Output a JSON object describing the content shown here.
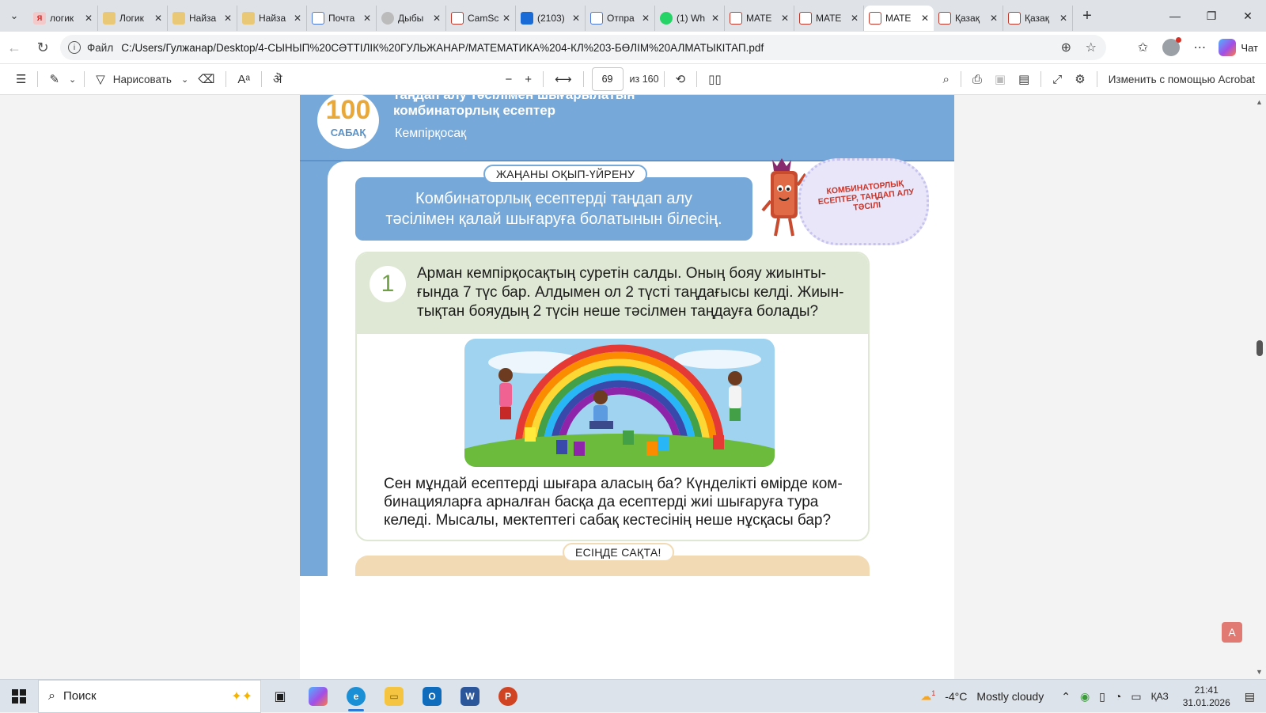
{
  "browser": {
    "tabs": [
      {
        "title": "логик",
        "icon": "yandex-icon"
      },
      {
        "title": "Логик",
        "icon": "image-icon"
      },
      {
        "title": "Найза",
        "icon": "image-icon"
      },
      {
        "title": "Найза",
        "icon": "image-icon"
      },
      {
        "title": "Почта",
        "icon": "mail-icon"
      },
      {
        "title": "Дыбы",
        "icon": "gear-icon"
      },
      {
        "title": "CamSc",
        "icon": "pdf-icon"
      },
      {
        "title": "(2103)",
        "icon": "outlook-icon"
      },
      {
        "title": "Отпра",
        "icon": "mail-icon"
      },
      {
        "title": "(1) Wh",
        "icon": "whatsapp-icon"
      },
      {
        "title": "МАТЕ",
        "icon": "pdf-icon"
      },
      {
        "title": "МАТЕ",
        "icon": "pdf-icon"
      },
      {
        "title": "МАТЕ",
        "icon": "pdf-icon",
        "active": true
      },
      {
        "title": "Қазақ",
        "icon": "pdf-icon"
      },
      {
        "title": "Қазақ",
        "icon": "pdf-icon"
      }
    ],
    "address": {
      "scheme": "Файл",
      "url": "C:/Users/Гулжанар/Desktop/4-СЫНЫП%20СӘТТІЛІК%20ГУЛЬЖАНАР/МАТЕМАТИКА%204-КЛ%203-БӨЛІМ%20АЛМАТЫКІТАП.pdf"
    },
    "copilot_label": "Чат"
  },
  "pdf_toolbar": {
    "draw_label": "Нарисовать",
    "page_current": "69",
    "page_total": "из 160",
    "acrobat_label": "Изменить с помощью Acrobat"
  },
  "document": {
    "lesson_number": "100",
    "lesson_label": "САБАҚ",
    "title_line1": "таңдап алу тәсілімен шығарылатын",
    "title_line2": "комбинаторлық есептер",
    "subtitle": "Кемпірқосақ",
    "learn_pill": "ЖАҢАНЫ ОҚЫП-ҮЙРЕНУ",
    "learn_text_line1": "Комбинаторлық есептерді таңдап алу",
    "learn_text_line2": "тәсілімен қалай шығаруға болатынын білесің.",
    "cloud_text": "КОМБИНАТОРЛЫҚ ЕСЕПТЕР, ТАҢДАП АЛУ ТӘСІЛІ",
    "task_number": "1",
    "task_line1": "Арман кемпірқосақтың суретін салды. Оның бояу жиынты-",
    "task_line2": "ғында 7 түс бар. Алдымен ол 2 түсті таңдағысы келді. Жиын-",
    "task_line3": "тықтан бояудың 2 түсін неше тәсілмен таңдауға болады?",
    "body_line1": "Сен мұндай есептерді шығара аласың ба? Күнделікті өмірде ком-",
    "body_line2": "бинацияларға арналған басқа да есептерді жиі шығаруға тура",
    "body_line3": "келеді. Мысалы, мектептегі сабақ кестесінің неше нұсқасы бар?",
    "remember_pill": "ЕСІҢДЕ САҚТА!"
  },
  "taskbar": {
    "search_placeholder": "Поиск",
    "weather_temp": "-4°C",
    "weather_text": "Mostly cloudy",
    "language": "ҚАЗ",
    "time": "21:41",
    "date": "31.01.2026",
    "notification_badge": "1"
  },
  "colors": {
    "page_blue": "#76a9d9",
    "task_green": "#dfe8d4",
    "remember_tan": "#f2dab4",
    "badge_orange": "#e9a93a"
  }
}
